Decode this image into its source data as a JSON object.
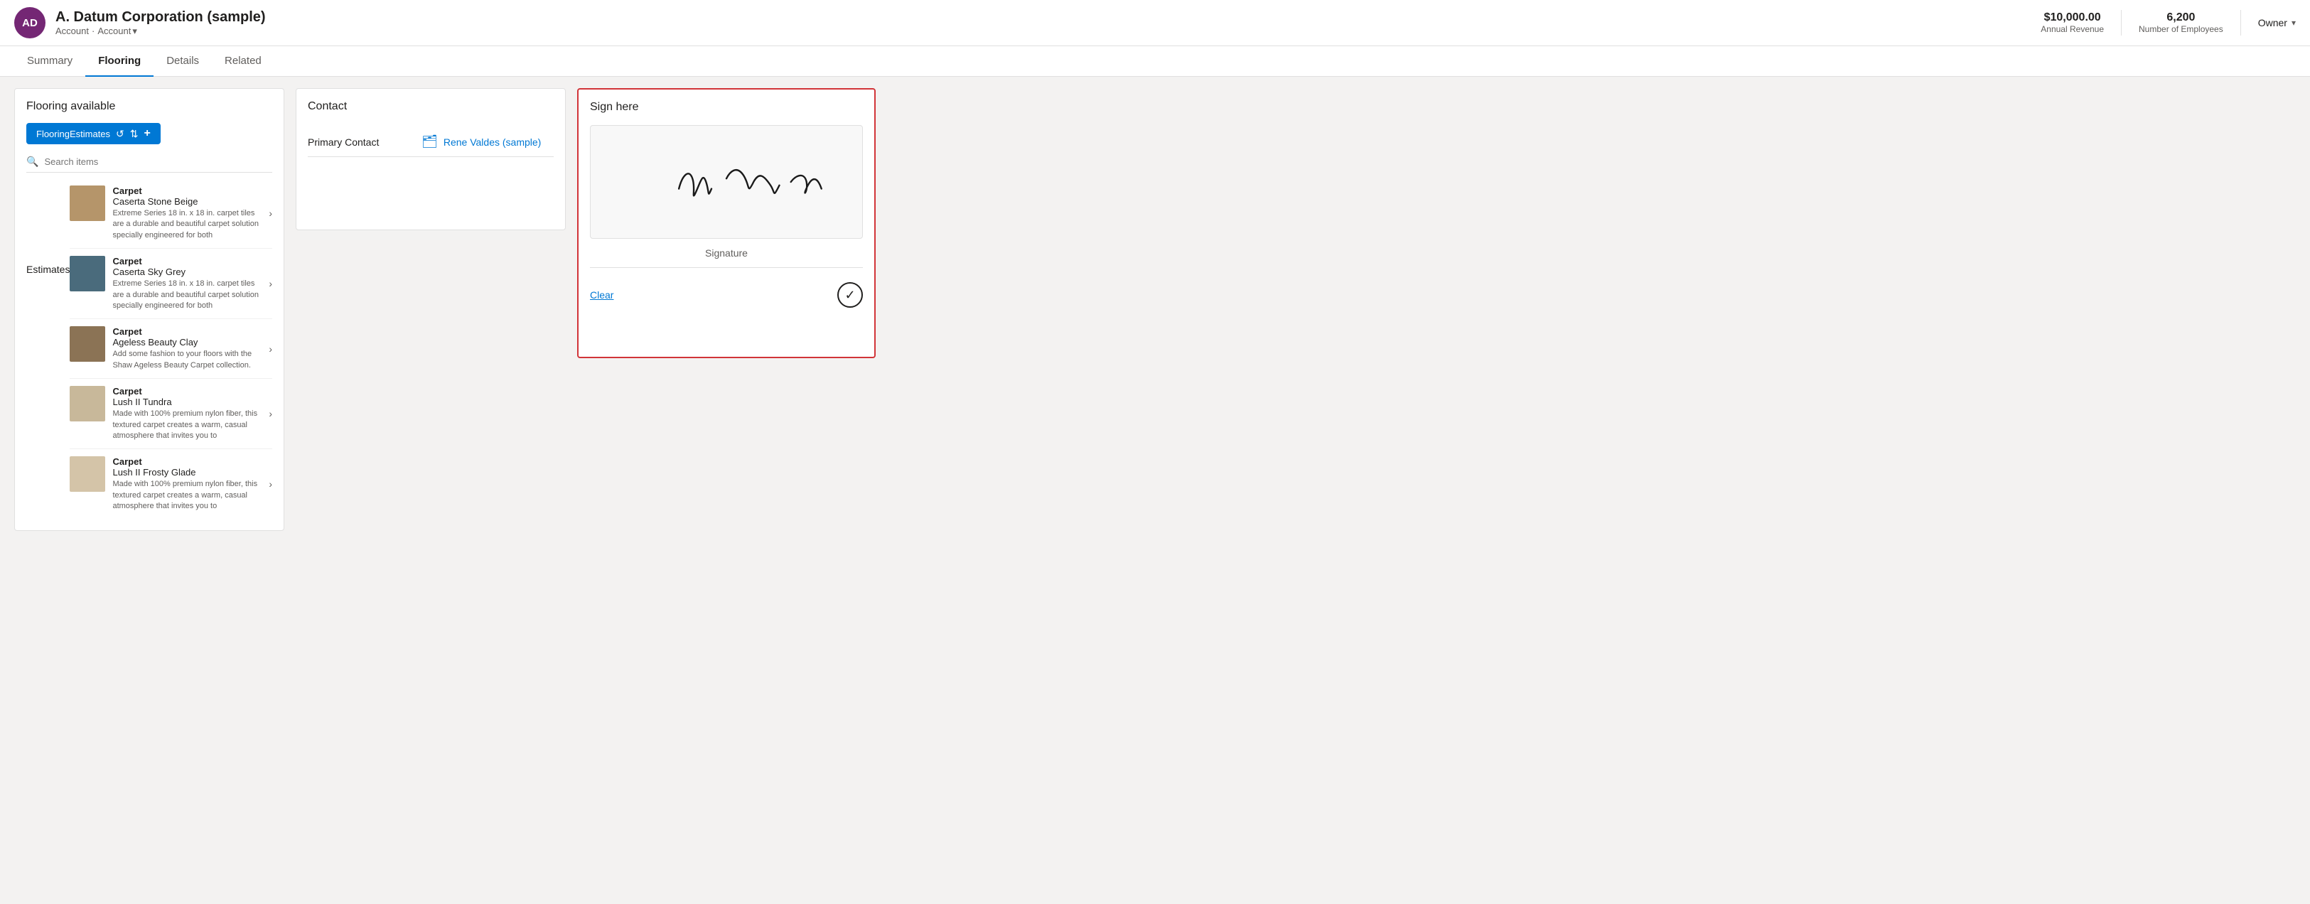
{
  "header": {
    "avatar_initials": "AD",
    "title": "A. Datum Corporation (sample)",
    "breadcrumb_type": "Account",
    "breadcrumb_separator": "·",
    "breadcrumb_subtype": "Account",
    "annual_revenue_label": "Annual Revenue",
    "annual_revenue_value": "$10,000.00",
    "employees_label": "Number of Employees",
    "employees_value": "6,200",
    "owner_label": "Owner"
  },
  "nav": {
    "tabs": [
      {
        "label": "Summary",
        "active": false
      },
      {
        "label": "Flooring",
        "active": true
      },
      {
        "label": "Details",
        "active": false
      },
      {
        "label": "Related",
        "active": false
      }
    ]
  },
  "flooring_panel": {
    "title": "Flooring available",
    "active_tab_label": "FlooringEstimates",
    "search_placeholder": "Search items",
    "estimates_label": "Estimates",
    "products": [
      {
        "category": "Carpet",
        "name": "Caserta Stone Beige",
        "description": "Extreme Series 18 in. x 18 in. carpet tiles are a durable and beautiful carpet solution specially engineered for both",
        "swatch": "carpet-beige"
      },
      {
        "category": "Carpet",
        "name": "Caserta Sky Grey",
        "description": "Extreme Series 18 in. x 18 in. carpet tiles are a durable and beautiful carpet solution specially engineered for both",
        "swatch": "carpet-grey"
      },
      {
        "category": "Carpet",
        "name": "Ageless Beauty Clay",
        "description": "Add some fashion to your floors with the Shaw Ageless Beauty Carpet collection.",
        "swatch": "carpet-clay"
      },
      {
        "category": "Carpet",
        "name": "Lush II Tundra",
        "description": "Made with 100% premium nylon fiber, this textured carpet creates a warm, casual atmosphere that invites you to",
        "swatch": "carpet-tundra"
      },
      {
        "category": "Carpet",
        "name": "Lush II Frosty Glade",
        "description": "Made with 100% premium nylon fiber, this textured carpet creates a warm, casual atmosphere that invites you to",
        "swatch": "carpet-frosty"
      }
    ]
  },
  "contact_panel": {
    "title": "Contact",
    "primary_contact_label": "Primary Contact",
    "primary_contact_name": "Rene Valdes (sample)"
  },
  "sign_panel": {
    "title": "Sign here",
    "signature_label": "Signature",
    "clear_label": "Clear"
  },
  "icons": {
    "chevron_down": "▾",
    "refresh": "↺",
    "sort": "⇅",
    "plus": "+",
    "search": "🔍",
    "arrow_right": "›",
    "contact": "🗂",
    "checkmark": "✓"
  }
}
